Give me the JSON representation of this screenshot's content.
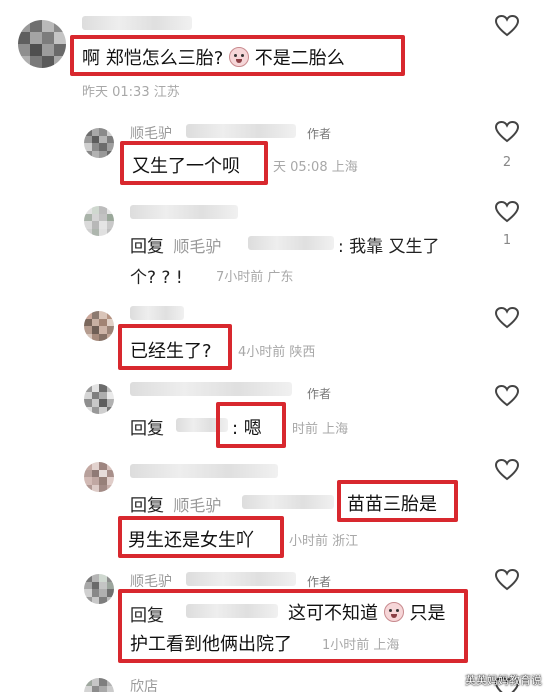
{
  "comments": [
    {
      "text_a": "啊 郑恺怎么三胎?",
      "text_b": "不是二胎么",
      "meta": "昨天 01:33 江苏",
      "likes": ""
    },
    {
      "name": "顺毛驴",
      "author_tag": "作者",
      "text": "又生了一个呗",
      "meta": "天 05:08 上海",
      "likes": "2"
    },
    {
      "reply_prefix": "回复",
      "reply_to": "顺毛驴",
      "text_a": ": 我靠 又生了",
      "text_b": "个? ? !",
      "meta": "7小时前 广东",
      "likes": "1"
    },
    {
      "text": "已经生了?",
      "meta": "4小时前 陕西",
      "likes": ""
    },
    {
      "author_tag": "作者",
      "reply_prefix": "回复",
      "text": ": 嗯",
      "meta": "时前 上海",
      "likes": ""
    },
    {
      "reply_prefix": "回复",
      "reply_to": "顺毛驴",
      "text_a": "苗苗三胎是",
      "text_b": "男生还是女生吖",
      "meta": "小时前 浙江",
      "likes": ""
    },
    {
      "name": "顺毛驴",
      "author_tag": "作者",
      "reply_prefix": "回复",
      "text_a": "这可不知道",
      "text_b": "只是",
      "text_c": "护工看到他俩出院了",
      "meta": "1小时前 上海",
      "likes": ""
    },
    {
      "name": "欣店"
    }
  ],
  "watermark": "英英妈妈教育说",
  "colors": {
    "highlight": "#d8282e",
    "meta": "#a8a8a8",
    "username": "#9a9a9a"
  },
  "icons": {
    "like": "heart-outline-icon",
    "reaction": "smiling-face-emoji-icon"
  }
}
